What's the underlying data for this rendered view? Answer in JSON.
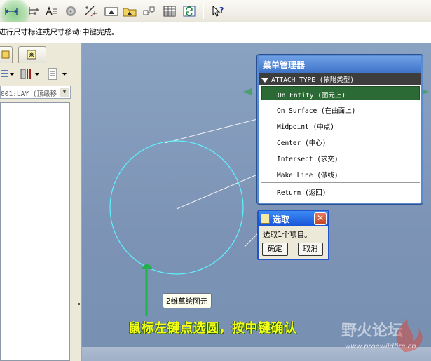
{
  "message_bar": {
    "text": "进行尺寸标注或尺寸移动:中键完成。"
  },
  "left_panel": {
    "layer_value": "001:LAY (顶级移"
  },
  "menu_manager": {
    "title": "菜单管理器",
    "section": "ATTACH TYPE (依附类型)",
    "items": [
      {
        "label": "On Entity (图元上)",
        "selected": true
      },
      {
        "label": "On Surface (在曲面上)",
        "selected": false
      },
      {
        "label": "Midpoint (中点)",
        "selected": false
      },
      {
        "label": "Center (中心)",
        "selected": false
      },
      {
        "label": "Intersect (求交)",
        "selected": false
      },
      {
        "label": "Make Line (做线)",
        "selected": false
      },
      {
        "label": "Return (返回)",
        "selected": false
      }
    ]
  },
  "select_dialog": {
    "title": "选取",
    "message": "选取1个项目。",
    "ok_label": "确定",
    "cancel_label": "取消",
    "close_glyph": "✕"
  },
  "tooltip": {
    "text": "2维草绘图元"
  },
  "instruction": {
    "text": "鼠标左键点选圆，按中键确认"
  },
  "watermark": {
    "text": "野火论坛",
    "url": "www.proewildfire.cn"
  },
  "colors": {
    "selected_item": "#2b6a34",
    "sketch_circle": "#5ff2ff",
    "annotation_green": "#22b14c",
    "caption_yellow": "#f6ff18",
    "viewport_bg": "#8aa2c2"
  },
  "icons": {
    "toolbar": [
      "dimension-icon",
      "baseline-icon",
      "text-icon",
      "palette-icon",
      "modify-icon",
      "constraint-icon",
      "folder-icon",
      "split-icon",
      "table-icon",
      "regenerate-icon",
      "help-icon"
    ]
  }
}
